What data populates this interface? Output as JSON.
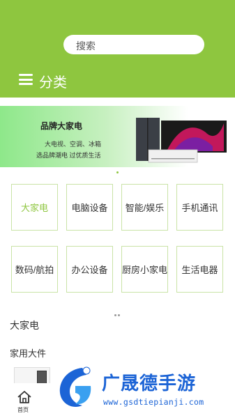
{
  "search": {
    "placeholder": "搜索"
  },
  "header": {
    "title": "分类"
  },
  "banner": {
    "title": "品牌大家电",
    "line1": "大电视、空调、冰箱",
    "line2": "选品牌潮电 过优质生活"
  },
  "categories": [
    {
      "label": "大家电",
      "active": true
    },
    {
      "label": "电脑设备",
      "active": false
    },
    {
      "label": "智能/娱乐",
      "active": false
    },
    {
      "label": "手机通讯",
      "active": false
    },
    {
      "label": "数码/航拍",
      "active": false
    },
    {
      "label": "办公设备",
      "active": false
    },
    {
      "label": "厨房小家电",
      "active": false
    },
    {
      "label": "生活电器",
      "active": false
    }
  ],
  "section": {
    "title": "大家电",
    "subtitle": "家用大件"
  },
  "tabbar": {
    "home_label": "首页"
  },
  "watermark": {
    "title": "广晟德手游",
    "url": "www.gsdtiepianji.com"
  },
  "colors": {
    "accent": "#8ec63f",
    "watermark_blue": "#1c64d6"
  }
}
